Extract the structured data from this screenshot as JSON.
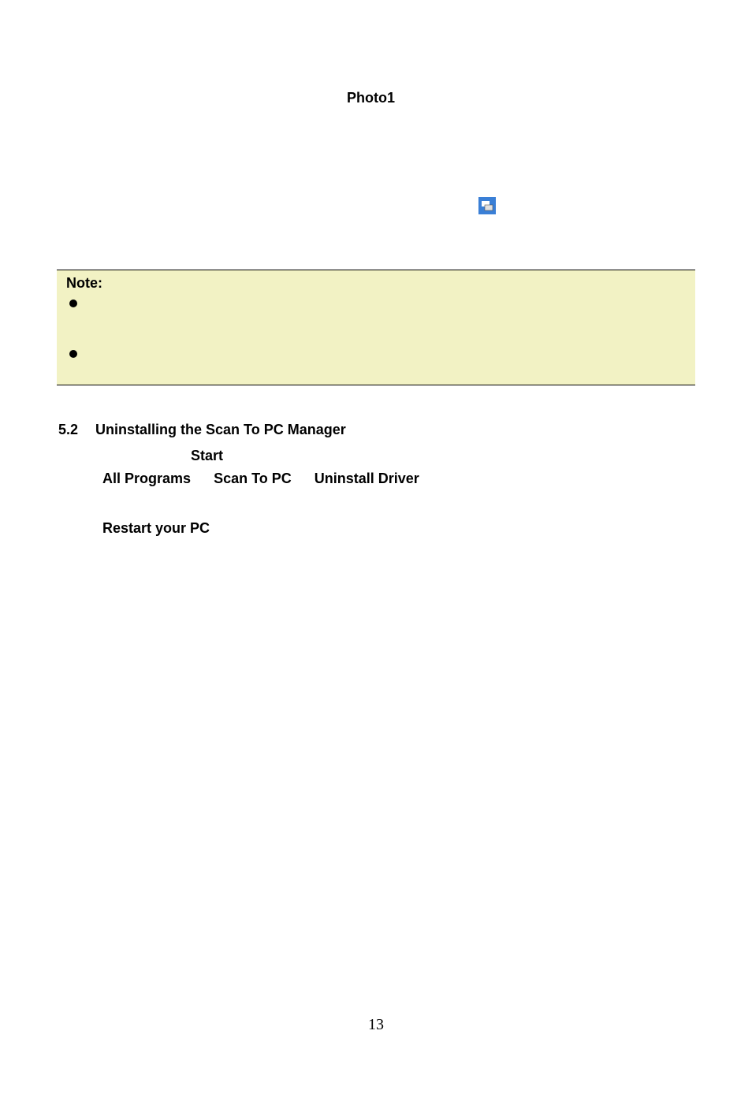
{
  "photo_label": "Photo1",
  "note": {
    "title": "Note:",
    "items": [
      "",
      ""
    ]
  },
  "section": {
    "number": "5.2",
    "title": "Uninstalling the Scan To PC Manager",
    "start": "Start",
    "all_programs": "All Programs",
    "scan_to_pc": "Scan To PC",
    "uninstall_driver": "Uninstall Driver",
    "restart_pc": "Restart your PC"
  },
  "page_number": "13"
}
